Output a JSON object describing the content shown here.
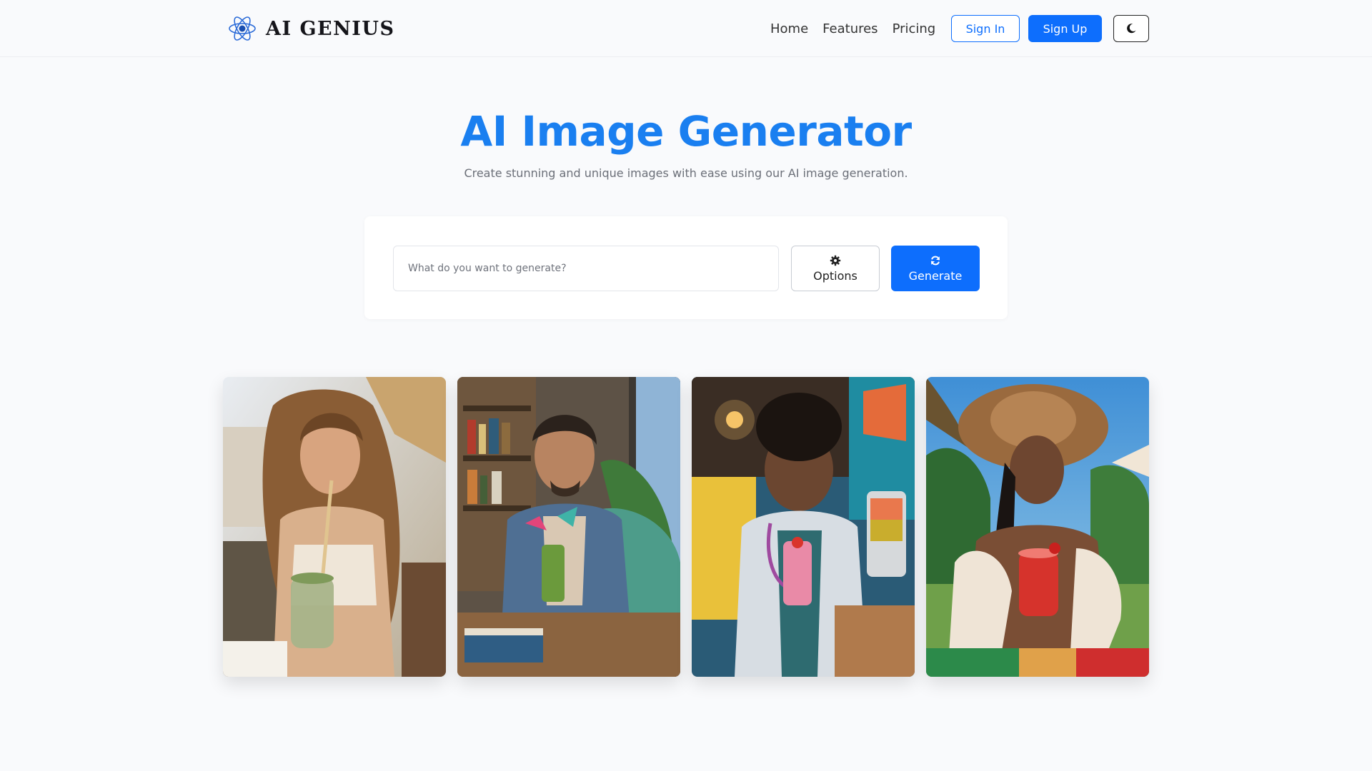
{
  "brand": {
    "name": "AI GENIUS",
    "logo_icon": "atom-icon"
  },
  "nav": {
    "links": [
      "Home",
      "Features",
      "Pricing"
    ],
    "signin_label": "Sign In",
    "signup_label": "Sign Up",
    "theme_icon": "moon-icon"
  },
  "hero": {
    "title": "AI Image Generator",
    "subtitle": "Create stunning and unique images with ease using our AI image generation."
  },
  "generator": {
    "prompt_placeholder": "What do you want to generate?",
    "prompt_value": "",
    "options_label": "Options",
    "options_icon": "gear-icon",
    "generate_label": "Generate",
    "generate_icon": "refresh-icon"
  },
  "gallery": {
    "images": [
      {
        "subject": "woman-drinking-green-smoothie"
      },
      {
        "subject": "man-holding-green-drink"
      },
      {
        "subject": "doctor-holding-pink-smoothie"
      },
      {
        "subject": "woman-in-sunhat-red-smoothie"
      }
    ]
  },
  "colors": {
    "accent": "#0d6efd",
    "title_blue": "#1a7ff0",
    "background": "#f9fafc"
  }
}
